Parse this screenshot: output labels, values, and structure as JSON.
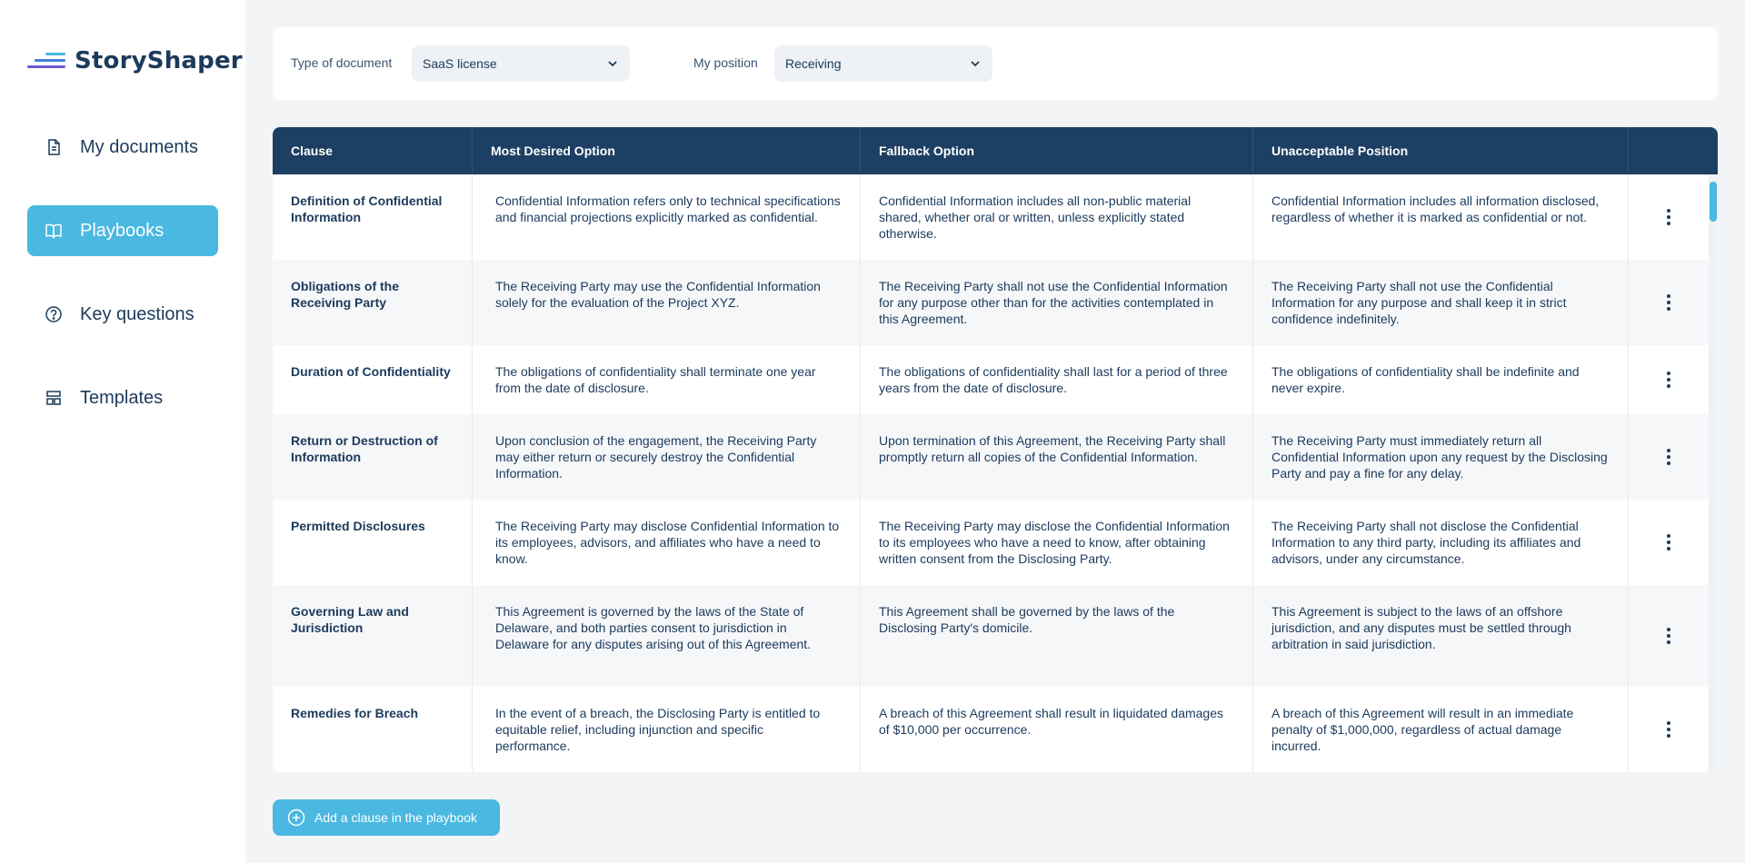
{
  "app": {
    "name": "StoryShaper"
  },
  "sidebar": {
    "items": [
      {
        "label": "My documents",
        "icon": "document-icon",
        "active": false
      },
      {
        "label": "Playbooks",
        "icon": "book-icon",
        "active": true
      },
      {
        "label": "Key questions",
        "icon": "question-icon",
        "active": false
      },
      {
        "label": "Templates",
        "icon": "template-icon",
        "active": false
      }
    ]
  },
  "filters": {
    "doc_type_label": "Type of document",
    "doc_type_value": "SaaS license",
    "position_label": "My position",
    "position_value": "Receiving"
  },
  "table": {
    "headers": [
      "Clause",
      "Most Desired Option",
      "Fallback Option",
      "Unacceptable Position"
    ],
    "rows": [
      {
        "clause": "Definition of Confidential Information",
        "desired": "Confidential Information refers only to technical specifications and financial projections explicitly marked as confidential.",
        "fallback": "Confidential Information includes all non-public material shared, whether oral or written, unless explicitly stated otherwise.",
        "unacceptable": "Confidential Information includes all information disclosed, regardless of whether it is marked as confidential or not."
      },
      {
        "clause": "Obligations of the Receiving Party",
        "desired": "The Receiving Party may use the Confidential Information solely for the evaluation of the Project XYZ.",
        "fallback": "The Receiving Party shall not use the Confidential Information for any purpose other than for the activities contemplated in this Agreement.",
        "unacceptable": "The Receiving Party shall not use the Confidential Information for any purpose and shall keep it in strict confidence indefinitely."
      },
      {
        "clause": "Duration of Confidentiality",
        "desired": "The obligations of confidentiality shall terminate one year from the date of disclosure.",
        "fallback": "The obligations of confidentiality shall last for a period of three years from the date of disclosure.",
        "unacceptable": "The obligations of confidentiality shall be indefinite and never expire."
      },
      {
        "clause": "Return or Destruction of Information",
        "desired": "Upon conclusion of the engagement, the Receiving Party may either return or securely destroy the Confidential Information.",
        "fallback": "Upon termination of this Agreement, the Receiving Party shall promptly return all copies of the Confidential Information.",
        "unacceptable": "The Receiving Party must immediately return all Confidential Information upon any request by the Disclosing Party and pay a fine for any delay."
      },
      {
        "clause": "Permitted Disclosures",
        "desired": "The Receiving Party may disclose Confidential Information to its employees, advisors, and affiliates who have a need to know.",
        "fallback": "The Receiving Party may disclose the Confidential Information to its employees who have a need to know, after obtaining written consent from the Disclosing Party.",
        "unacceptable": "The Receiving Party shall not disclose the Confidential Information to any third party, including its affiliates and advisors, under any circumstance."
      },
      {
        "clause": "Governing Law and Jurisdiction",
        "desired": "This Agreement is governed by the laws of the State of Delaware, and both parties consent to jurisdiction in Delaware for any disputes arising out of this Agreement.",
        "fallback": "This Agreement shall be governed by the laws of the Disclosing Party's domicile.",
        "unacceptable": "This Agreement is subject to the laws of an offshore jurisdiction, and any disputes must be settled through arbitration in said jurisdiction."
      },
      {
        "clause": "Remedies for Breach",
        "desired": "In the event of a breach, the Disclosing Party is entitled to equitable relief, including injunction and specific performance.",
        "fallback": "A breach of this Agreement shall result in liquidated damages of $10,000 per occurrence.",
        "unacceptable": "A breach of this Agreement will result in an immediate penalty of $1,000,000, regardless of actual damage incurred."
      }
    ]
  },
  "actions": {
    "add_clause_label": "Add a clause in the playbook"
  },
  "colors": {
    "accent": "#4ab8e0",
    "header": "#1d3f63",
    "text": "#1b3a5c"
  }
}
